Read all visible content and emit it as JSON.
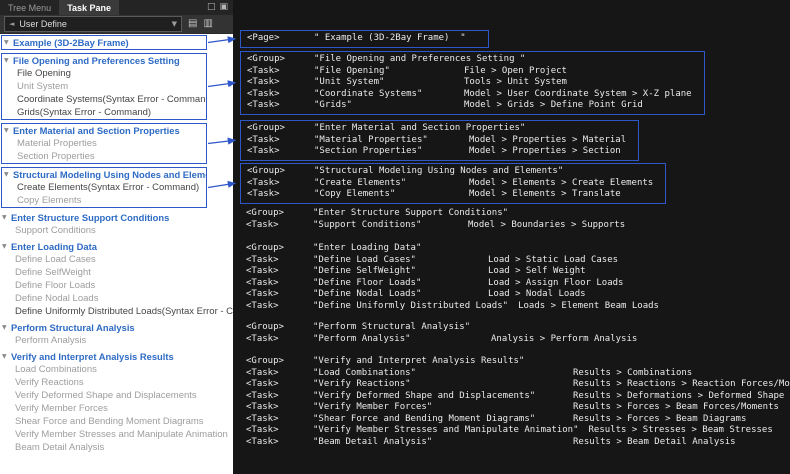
{
  "window": {
    "tabs": [
      {
        "label": "Tree Menu",
        "active": false
      },
      {
        "label": "Task Pane",
        "active": true
      }
    ],
    "toolbar": {
      "preset": "User Define"
    }
  },
  "tree": {
    "root": {
      "label": "Example (3D-2Bay Frame)"
    },
    "sections": [
      {
        "label": "File Opening and Preferences Setting",
        "boxed": true,
        "items": [
          {
            "label": "File Opening",
            "muted": false
          },
          {
            "label": "Unit System",
            "muted": true
          },
          {
            "label": "Coordinate Systems(Syntax Error - Command)",
            "muted": false
          },
          {
            "label": "Grids(Syntax Error - Command)",
            "muted": false
          }
        ]
      },
      {
        "label": "Enter Material and Section Properties",
        "boxed": true,
        "items": [
          {
            "label": "Material Properties",
            "muted": true
          },
          {
            "label": "Section Properties",
            "muted": true
          }
        ]
      },
      {
        "label": "Structural Modeling Using Nodes and Elements",
        "boxed": true,
        "items": [
          {
            "label": "Create Elements(Syntax Error - Command)",
            "muted": false
          },
          {
            "label": "Copy Elements",
            "muted": true
          }
        ]
      },
      {
        "label": "Enter Structure Support Conditions",
        "boxed": false,
        "items": [
          {
            "label": "Support Conditions",
            "muted": true
          }
        ]
      },
      {
        "label": "Enter Loading Data",
        "boxed": false,
        "items": [
          {
            "label": "Define Load Cases",
            "muted": true
          },
          {
            "label": "Define SelfWeight",
            "muted": true
          },
          {
            "label": "Define Floor Loads",
            "muted": true
          },
          {
            "label": "Define Nodal Loads",
            "muted": true
          },
          {
            "label": "Define Uniformly Distributed Loads(Syntax Error - Command)",
            "muted": false
          }
        ]
      },
      {
        "label": "Perform Structural Analysis",
        "boxed": false,
        "items": [
          {
            "label": "Perform Analysis",
            "muted": true
          }
        ]
      },
      {
        "label": "Verify and Interpret Analysis Results",
        "boxed": false,
        "items": [
          {
            "label": "Load Combinations",
            "muted": true
          },
          {
            "label": "Verify Reactions",
            "muted": true
          },
          {
            "label": "Verify Deformed Shape and Displacements",
            "muted": true
          },
          {
            "label": "Verify Member Forces",
            "muted": true
          },
          {
            "label": "Shear Force and Bending Moment Diagrams",
            "muted": true
          },
          {
            "label": "Verify Member Stresses and Manipulate Animation",
            "muted": true
          },
          {
            "label": "Beam Detail Analysis",
            "muted": true
          }
        ]
      }
    ]
  },
  "code": {
    "page_tag": "<Page>",
    "group_tag": "<Group>",
    "task_tag": "<Task>",
    "page_name": "\" Example (3D-2Bay Frame)  \"",
    "blocks": [
      {
        "boxed": true,
        "group_name": "\"File Opening and Preferences Setting \"",
        "tasks": [
          {
            "name": "\"File Opening\"",
            "path": "File > Open Project"
          },
          {
            "name": "\"Unit System\"",
            "path": "Tools > Unit System"
          },
          {
            "name": "\"Coordinate Systems\"",
            "path": "Model > User Coordinate System > X-Z plane"
          },
          {
            "name": "\"Grids\"",
            "path": "Model > Grids > Define Point Grid"
          }
        ]
      },
      {
        "boxed": true,
        "group_name": "\"Enter Material and Section Properties\"",
        "tasks": [
          {
            "name": "\"Material Properties\"",
            "path": "Model > Properties > Material"
          },
          {
            "name": "\"Section Properties\"",
            "path": "Model > Properties > Section"
          }
        ]
      },
      {
        "boxed": true,
        "group_name": "\"Structural Modeling Using Nodes and Elements\"",
        "tasks": [
          {
            "name": "\"Create Elements\"",
            "path": "Model > Elements > Create Elements"
          },
          {
            "name": "\"Copy Elements\"",
            "path": "Model > Elements > Translate"
          }
        ]
      },
      {
        "boxed": false,
        "group_name": "\"Enter Structure Support Conditions\"",
        "tasks": [
          {
            "name": "\"Support Conditions\"",
            "path": "Model > Boundaries > Supports"
          }
        ]
      },
      {
        "boxed": false,
        "group_name": "\"Enter Loading Data\"",
        "tasks": [
          {
            "name": "\"Define Load Cases\"",
            "path": "Load > Static Load Cases"
          },
          {
            "name": "\"Define SelfWeight\"",
            "path": "Load > Self Weight"
          },
          {
            "name": "\"Define Floor Loads\"",
            "path": "Load > Assign Floor Loads"
          },
          {
            "name": "\"Define Nodal Loads\"",
            "path": "Load > Nodal Loads"
          },
          {
            "name": "\"Define Uniformly Distributed Loads\"",
            "path": "Loads > Element Beam Loads"
          }
        ]
      },
      {
        "boxed": false,
        "group_name": "\"Perform Structural Analysis\"",
        "tasks": [
          {
            "name": "\"Perform Analysis\"",
            "path": "Analysis > Perform Analysis"
          }
        ]
      },
      {
        "boxed": false,
        "group_name": "\"Verify and Interpret Analysis Results\"",
        "tasks": [
          {
            "name": "\"Load Combinations\"",
            "path": "Results > Combinations"
          },
          {
            "name": "\"Verify Reactions\"",
            "path": "Results > Reactions > Reaction Forces/Momen"
          },
          {
            "name": "\"Verify Deformed Shape and Displacements\"",
            "path": "Results > Deformations > Deformed Shape"
          },
          {
            "name": "\"Verify Member Forces\"",
            "path": "Results > Forces > Beam Forces/Moments"
          },
          {
            "name": "\"Shear Force and Bending Moment Diagrams\"",
            "path": "Results > Forces > Beam Diagrams"
          },
          {
            "name": "\"Verify Member Stresses and Manipulate Animation\"",
            "path": "Results > Stresses > Beam Stresses"
          },
          {
            "name": "\"Beam Detail Analysis\"",
            "path": "Results > Beam Detail Analysis"
          }
        ]
      }
    ]
  },
  "colors": {
    "annotation": "#2e57c9",
    "group_header": "#2e6bc4",
    "code_text": "#eaeaea"
  }
}
